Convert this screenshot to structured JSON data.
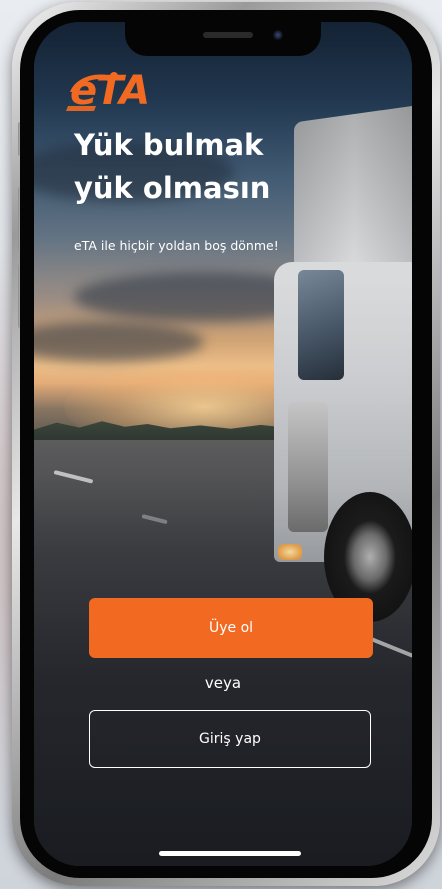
{
  "app": {
    "logo_text": "eTA"
  },
  "hero": {
    "headline_line1": "Yük bulmak",
    "headline_line2": "yük olmasın",
    "tagline": "eTA ile hiçbir yoldan boş dönme!"
  },
  "actions": {
    "signup_label": "Üye ol",
    "or_label": "veya",
    "login_label": "Giriş yap"
  },
  "colors": {
    "accent": "#f26a21",
    "text": "#ffffff"
  },
  "icons": {
    "logo": "eta-logo",
    "background": "truck-on-highway-photo"
  }
}
